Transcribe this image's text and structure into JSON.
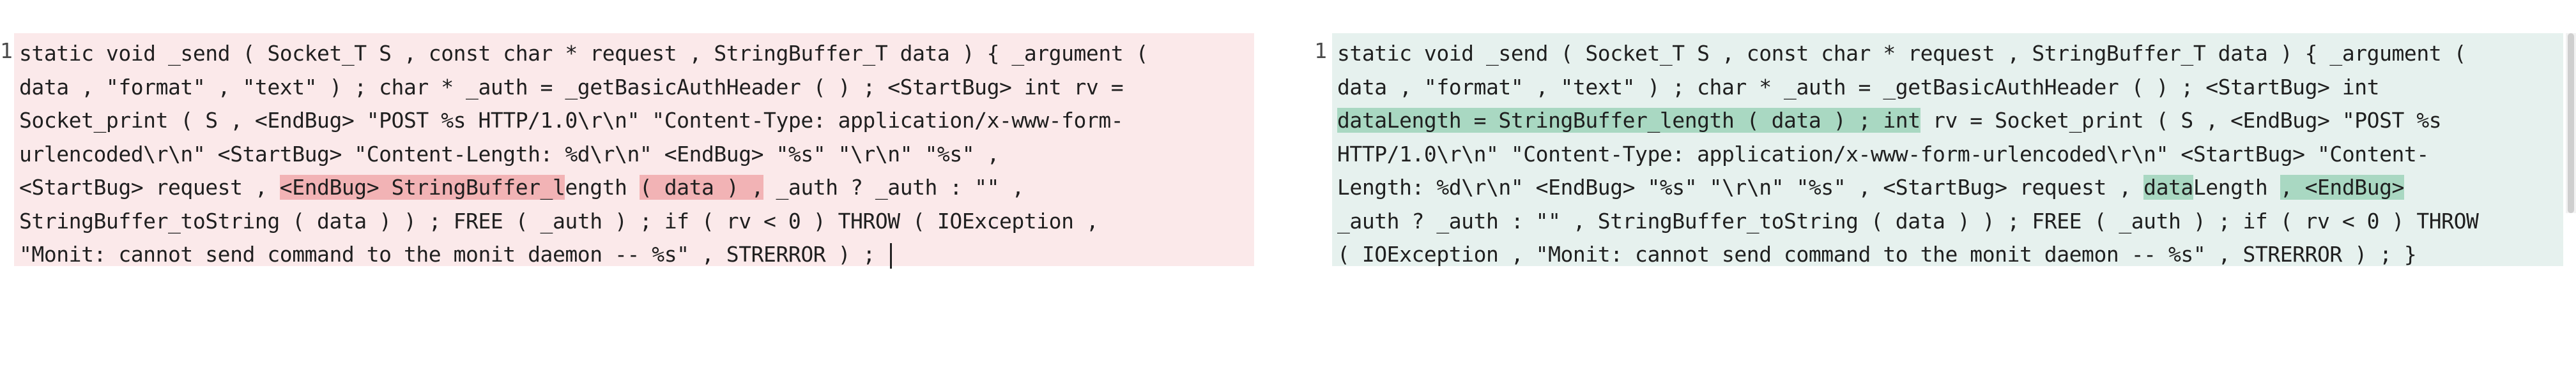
{
  "colors": {
    "removed_bg": "#fbe9ea",
    "removed_highlight": "#f2b3b5",
    "added_bg": "#e6f1ee",
    "added_highlight": "#a9d8c2"
  },
  "left": {
    "line_number": "1",
    "lines": [
      [
        {
          "t": "static void _send ( Socket_T S , const char * request , StringBuffer_T data ) { _argument (",
          "h": false
        }
      ],
      [
        {
          "t": "data , \"format\" , \"text\" ) ; char * _auth = _getBasicAuthHeader ( ) ; <StartBug> int rv =",
          "h": false
        }
      ],
      [
        {
          "t": "Socket_print ( S , <EndBug> \"POST %s HTTP/1.0\\r\\n\" \"Content-Type: application/x-www-form-",
          "h": false
        }
      ],
      [
        {
          "t": "urlencoded\\r\\n\" <StartBug> \"Content-Length: %d\\r\\n\" <EndBug> \"%s\" \"\\r\\n\" \"%s\" ,",
          "h": false
        }
      ],
      [
        {
          "t": "<StartBug> request , ",
          "h": false
        },
        {
          "t": "<EndBug> StringBuffer_l",
          "h": true
        },
        {
          "t": "ength ",
          "h": false
        },
        {
          "t": "( data ) ,",
          "h": true
        },
        {
          "t": " _auth ? _auth : \"\" ,",
          "h": false
        }
      ],
      [
        {
          "t": "StringBuffer_toString ( data ) ) ; FREE ( _auth ) ; if ( rv < 0 ) THROW ( IOException ,",
          "h": false
        }
      ],
      [
        {
          "t": "\"Monit: cannot send command to the monit daemon -- %s\" , STRERROR ) ; ",
          "h": false
        }
      ]
    ]
  },
  "right": {
    "line_number": "1",
    "lines": [
      [
        {
          "t": "static void _send ( Socket_T S , const char * request , StringBuffer_T data ) { _argument (",
          "h": false
        }
      ],
      [
        {
          "t": "data , \"format\" , \"text\" ) ; char * _auth = _getBasicAuthHeader ( ) ; <StartBug> int",
          "h": false
        }
      ],
      [
        {
          "t": "dataLength = StringBuffer_length ( data ) ; int",
          "h": true
        },
        {
          "t": " rv = Socket_print ( S , <EndBug> \"POST %s",
          "h": false
        }
      ],
      [
        {
          "t": "HTTP/1.0\\r\\n\" \"Content-Type: application/x-www-form-urlencoded\\r\\n\" <StartBug> \"Content-",
          "h": false
        }
      ],
      [
        {
          "t": "Length: %d\\r\\n\" <EndBug> \"%s\" \"\\r\\n\" \"%s\" , <StartBug> request , ",
          "h": false
        },
        {
          "t": "data",
          "h": true
        },
        {
          "t": "Length ",
          "h": false
        },
        {
          "t": ", <EndBug>",
          "h": true
        }
      ],
      [
        {
          "t": "_auth ? _auth : \"\" , StringBuffer_toString ( data ) ) ; FREE ( _auth ) ; if ( rv < 0 ) THROW",
          "h": false
        }
      ],
      [
        {
          "t": "( IOException , \"Monit: cannot send command to the monit daemon -- %s\" , STRERROR ) ; }",
          "h": false
        }
      ]
    ]
  }
}
